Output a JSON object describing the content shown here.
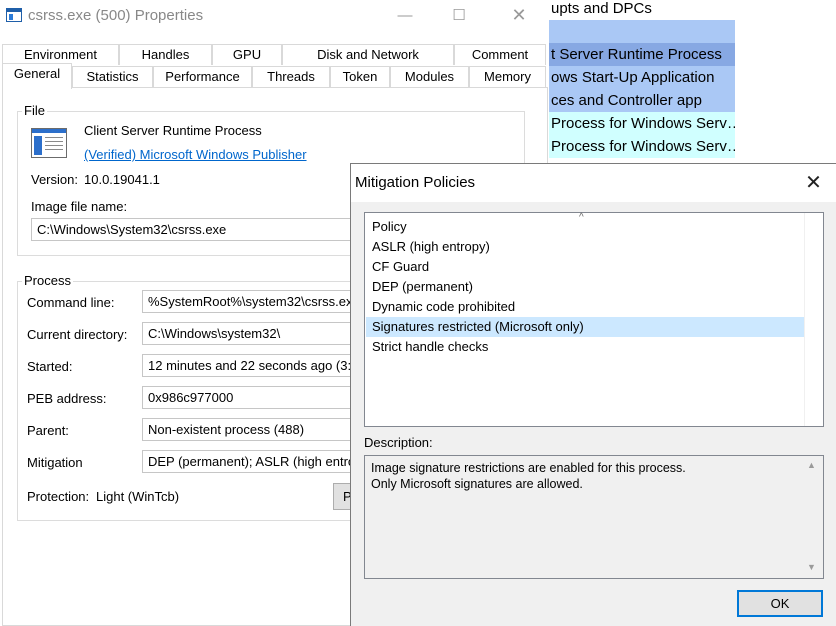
{
  "background_list": {
    "rows": [
      {
        "text": "upts and DPCs",
        "bg": "#ffffff"
      },
      {
        "text": "",
        "bg": "#aac8f5"
      },
      {
        "text": "t Server Runtime Process",
        "bg": "#87a8e3"
      },
      {
        "text": "ows Start-Up Application",
        "bg": "#aac8f5"
      },
      {
        "text": "ces and Controller app",
        "bg": "#aac8f5"
      },
      {
        "text": "Process for Windows Serv…",
        "bg": "#d0ffff"
      },
      {
        "text": "Process for Windows Serv…",
        "bg": "#d0ffff"
      }
    ]
  },
  "properties_window": {
    "title": "csrss.exe (500) Properties",
    "window_buttons": {
      "minimize": "—",
      "maximize": "☐",
      "close": "✕"
    },
    "tabs_row1": [
      "Environment",
      "Handles",
      "GPU",
      "Disk and Network",
      "Comment"
    ],
    "tabs_row2": [
      "General",
      "Statistics",
      "Performance",
      "Threads",
      "Token",
      "Modules",
      "Memory"
    ],
    "active_tab": "General",
    "file": {
      "group_label": "File",
      "description": "Client Server Runtime Process",
      "publisher_link": "(Verified) Microsoft Windows Publisher",
      "version_label": "Version:",
      "version_value": "10.0.19041.1",
      "image_label": "Image file name:",
      "image_path": "C:\\Windows\\System32\\csrss.exe"
    },
    "process": {
      "group_label": "Process",
      "command_line_label": "Command line:",
      "command_line_value": "%SystemRoot%\\system32\\csrss.exe",
      "current_dir_label": "Current directory:",
      "current_dir_value": "C:\\Windows\\system32\\",
      "started_label": "Started:",
      "started_value": "12 minutes and 22 seconds ago (3:",
      "peb_label": "PEB address:",
      "peb_value": "0x986c977000",
      "parent_label": "Parent:",
      "parent_value": "Non-existent process (488)",
      "mitigation_label": "Mitigation",
      "mitigation_value": "DEP (permanent); ASLR (high entro",
      "protection_label": "Protection:",
      "protection_value": "Light (WinTcb)",
      "partial_button": "P"
    }
  },
  "mitigation_dialog": {
    "title": "Mitigation Policies",
    "close_glyph": "✕",
    "column_header": "Policy",
    "sort_glyph": "^",
    "policies": [
      "ASLR (high entropy)",
      "CF Guard",
      "DEP (permanent)",
      "Dynamic code prohibited",
      "Signatures restricted (Microsoft only)",
      "Strict handle checks"
    ],
    "selected_index": 4,
    "description_label": "Description:",
    "description_text": "Image signature restrictions are enabled for this process.\nOnly Microsoft signatures are allowed.",
    "scroll_up": "▲",
    "scroll_down": "▼",
    "ok_label": "OK"
  }
}
